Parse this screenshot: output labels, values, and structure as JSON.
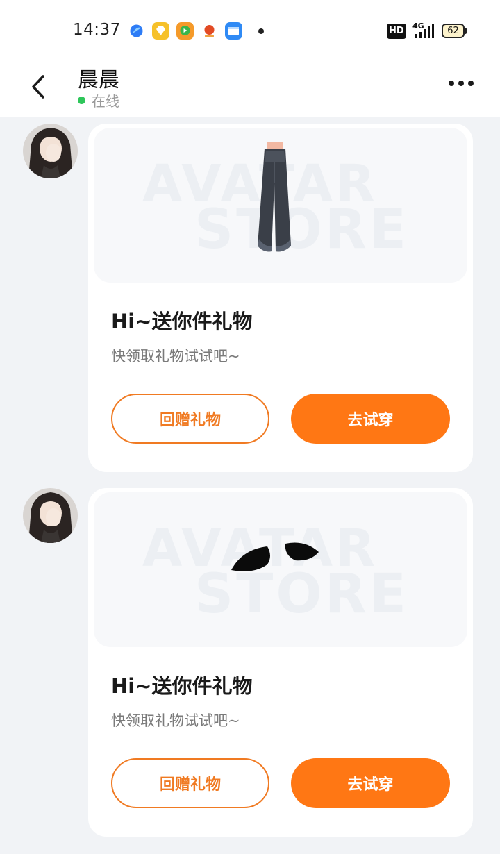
{
  "status_bar": {
    "time": "14:37",
    "hd": "HD",
    "network": "4G",
    "battery": "62"
  },
  "header": {
    "name": "晨晨",
    "status": "在线"
  },
  "messages": [
    {
      "title": "Hi~送你件礼物",
      "subtitle": "快领取礼物试试吧~",
      "return_label": "回赠礼物",
      "try_label": "去试穿",
      "watermark_line1": "AVATAR",
      "watermark_line2": "STORE",
      "item": "jeans"
    },
    {
      "title": "Hi~送你件礼物",
      "subtitle": "快领取礼物试试吧~",
      "return_label": "回赠礼物",
      "try_label": "去试穿",
      "watermark_line1": "AVATAR",
      "watermark_line2": "STORE",
      "item": "eyebrows"
    }
  ],
  "colors": {
    "accent": "#ff7714",
    "online": "#2ec65a"
  }
}
